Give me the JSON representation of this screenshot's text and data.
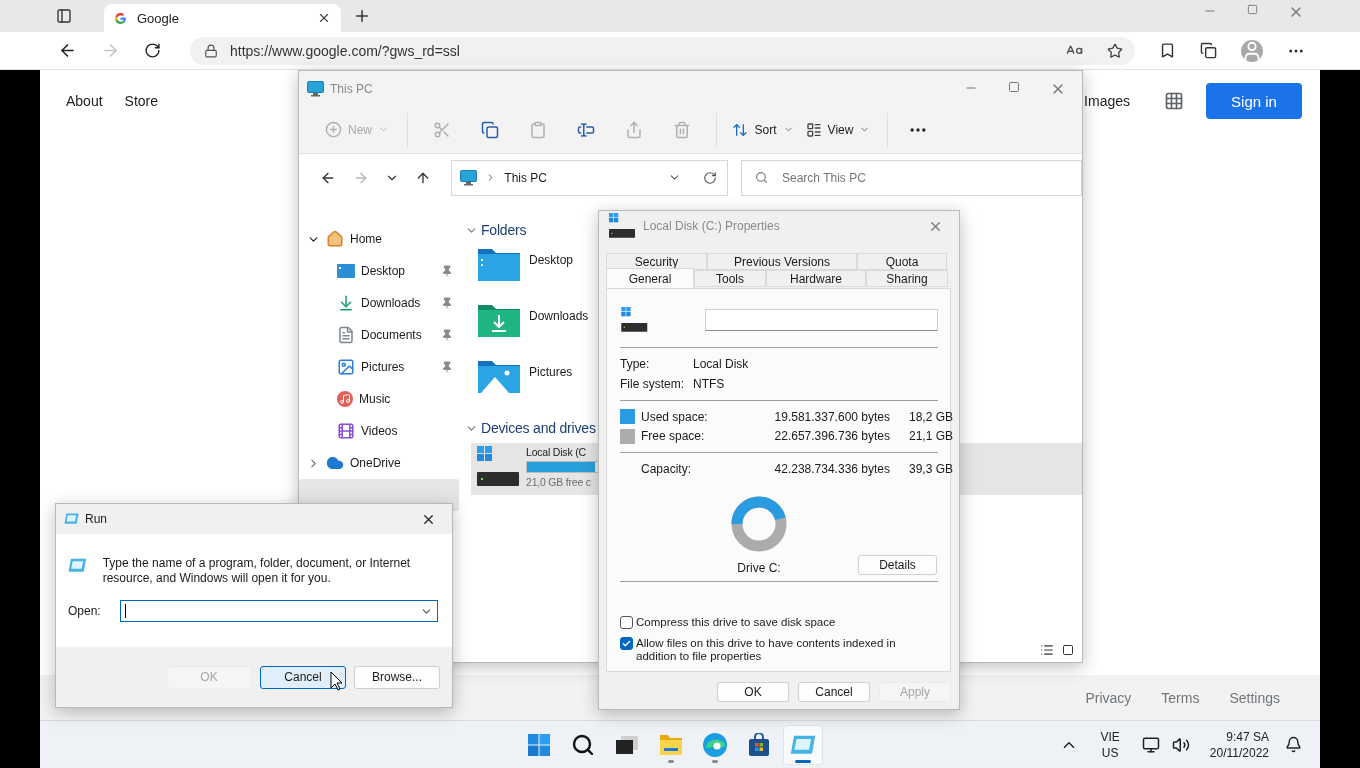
{
  "browser": {
    "tabs": [
      {
        "title": "Google",
        "selected": true
      }
    ],
    "address": "https://www.google.com/?gws_rd=ssl"
  },
  "google_page": {
    "header_links": [
      "About",
      "Store"
    ],
    "images_link": "Images",
    "sign_in": "Sign in",
    "footer_links": [
      "Privacy",
      "Terms",
      "Settings"
    ]
  },
  "explorer": {
    "title": "This PC",
    "toolbar": [
      {
        "kind": "new",
        "label": "New",
        "disabled": true
      },
      {
        "kind": "cut",
        "disabled": true
      },
      {
        "kind": "copy",
        "disabled": false
      },
      {
        "kind": "paste",
        "disabled": true
      },
      {
        "kind": "rename",
        "disabled": false
      },
      {
        "kind": "share",
        "disabled": true
      },
      {
        "kind": "delete",
        "disabled": true
      },
      {
        "kind": "sort",
        "label": "Sort",
        "disabled": false
      },
      {
        "kind": "view",
        "label": "View",
        "disabled": false
      },
      {
        "kind": "more"
      }
    ],
    "nav_buttons": [
      {
        "kind": "back",
        "disabled": false
      },
      {
        "kind": "forward",
        "disabled": true
      },
      {
        "kind": "recent",
        "disabled": false
      },
      {
        "kind": "up",
        "disabled": false
      }
    ],
    "address": "This PC",
    "search_placeholder": "Search This PC",
    "sidebar": {
      "items": [
        {
          "label": "Home",
          "expanded": true,
          "selected": false,
          "children": [
            {
              "label": "Desktop",
              "pinned": true,
              "selected": false
            },
            {
              "label": "Downloads",
              "pinned": true,
              "selected": false
            },
            {
              "label": "Documents",
              "pinned": true,
              "selected": false
            },
            {
              "label": "Pictures",
              "pinned": true,
              "selected": false
            },
            {
              "label": "Music",
              "pinned": false,
              "selected": false
            },
            {
              "label": "Videos",
              "pinned": false,
              "selected": false
            }
          ]
        },
        {
          "label": "OneDrive",
          "expanded": false,
          "selected": false
        },
        {
          "selected": true
        }
      ]
    },
    "sections": [
      {
        "title": "Folders",
        "expanded": true,
        "items": [
          {
            "kind": "folder",
            "name": "Desktop",
            "selected": false
          },
          {
            "kind": "folder",
            "name": "Downloads",
            "selected": false
          },
          {
            "kind": "folder",
            "name": "Pictures",
            "selected": false
          }
        ]
      },
      {
        "title": "Devices and drives",
        "expanded": true,
        "items": [
          {
            "kind": "drive",
            "name": "Local Disk (C",
            "free": "21,0 GB free c",
            "level": 0.46,
            "selected": true
          }
        ]
      }
    ]
  },
  "properties": {
    "title": "Local Disk (C:) Properties",
    "tab_rows": [
      [
        {
          "label": "Security",
          "selected": false
        },
        {
          "label": "Previous Versions",
          "selected": false
        },
        {
          "label": "Quota",
          "selected": false
        }
      ],
      [
        {
          "label": "General",
          "selected": true
        },
        {
          "label": "Tools",
          "selected": false
        },
        {
          "label": "Hardware",
          "selected": false
        },
        {
          "label": "Sharing",
          "selected": false
        }
      ]
    ],
    "info": [
      {
        "label": "Type:",
        "value": "Local Disk"
      },
      {
        "label": "File system:",
        "value": "NTFS"
      }
    ],
    "space": [
      {
        "label": "Used space:",
        "bytes": "19.581.337.600 bytes",
        "size": "18,2 GB",
        "color": "#2a9be0"
      },
      {
        "label": "Free space:",
        "bytes": "22.657.396.736 bytes",
        "size": "21,1 GB",
        "color": "#ababab"
      }
    ],
    "capacity": {
      "label": "Capacity:",
      "bytes": "42.238.734.336 bytes",
      "size": "39,3 GB"
    },
    "drive_label": "Drive C:",
    "details_button": "Details",
    "options": [
      {
        "label": "Compress this drive to save disk space",
        "checked": false
      },
      {
        "label": "Allow files on this drive to have contents indexed in addition to file properties",
        "checked": true
      }
    ],
    "buttons": [
      {
        "label": "OK",
        "disabled": false
      },
      {
        "label": "Cancel",
        "disabled": false
      },
      {
        "label": "Apply",
        "disabled": true
      }
    ]
  },
  "run": {
    "title": "Run",
    "description": "Type the name of a program, folder, document, or Internet resource, and Windows will open it for you.",
    "open_label": "Open:",
    "buttons": [
      {
        "label": "OK",
        "disabled": true,
        "focused": false
      },
      {
        "label": "Cancel",
        "disabled": false,
        "focused": true
      },
      {
        "label": "Browse...",
        "disabled": false,
        "focused": false
      }
    ]
  },
  "taskbar": {
    "apps": [
      {
        "kind": "start",
        "running": false,
        "active": false
      },
      {
        "kind": "search",
        "running": false,
        "active": false
      },
      {
        "kind": "taskview",
        "running": false,
        "active": false
      },
      {
        "kind": "explorer",
        "running": true,
        "active": false
      },
      {
        "kind": "edge",
        "running": true,
        "active": false
      },
      {
        "kind": "store",
        "running": false,
        "active": false
      },
      {
        "kind": "run",
        "running": true,
        "active": true
      }
    ],
    "language": [
      "VIE",
      "US"
    ],
    "time": "9:47 SA",
    "date": "20/11/2022"
  }
}
